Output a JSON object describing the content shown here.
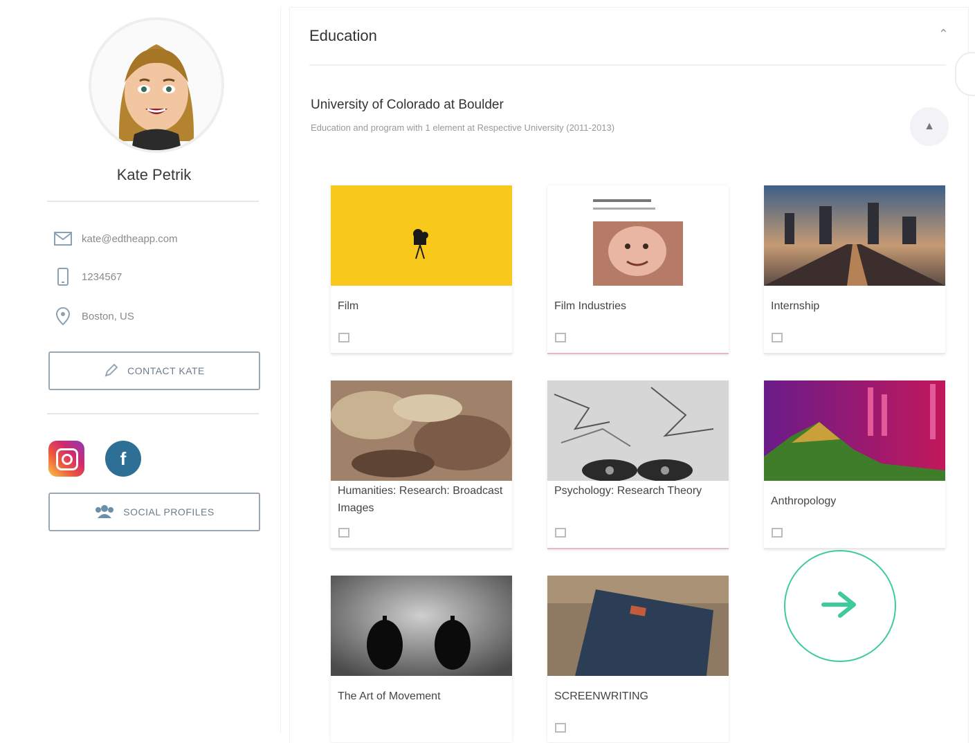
{
  "profile": {
    "name": "Kate Petrik",
    "email": "kate@edtheapp.com",
    "phone": "1234567",
    "location": "Boston, US",
    "contact_button": "CONTACT KATE",
    "social_button": "SOCIAL PROFILES",
    "social_icons": [
      "instagram-icon",
      "facebook-icon"
    ]
  },
  "education": {
    "title": "Education",
    "institution": "University of Colorado at Boulder",
    "subtitle": "Education and program with 1 element at Respective University (2011-2013)",
    "courses": [
      {
        "label": "Film",
        "underline": "#e8e8e8"
      },
      {
        "label": "Film Industries",
        "underline": "#e7b9c7"
      },
      {
        "label": "Internship",
        "underline": "#e8e8e8"
      },
      {
        "label": "Humanities: Research: Broadcast Images",
        "underline": "#e8e8e8"
      },
      {
        "label": "Psychology: Research Theory",
        "underline": "#e7b9c7"
      },
      {
        "label": "Anthropology",
        "underline": "#e8e8e8"
      },
      {
        "label": "The Art of Movement",
        "underline": "#e8e8e8"
      },
      {
        "label": "SCREENWRITING",
        "underline": "#e8e8e8"
      }
    ]
  },
  "colors": {
    "accent": "#3ecb9c",
    "button_border": "#9aa7b3",
    "film_yellow": "#f8c91a"
  }
}
